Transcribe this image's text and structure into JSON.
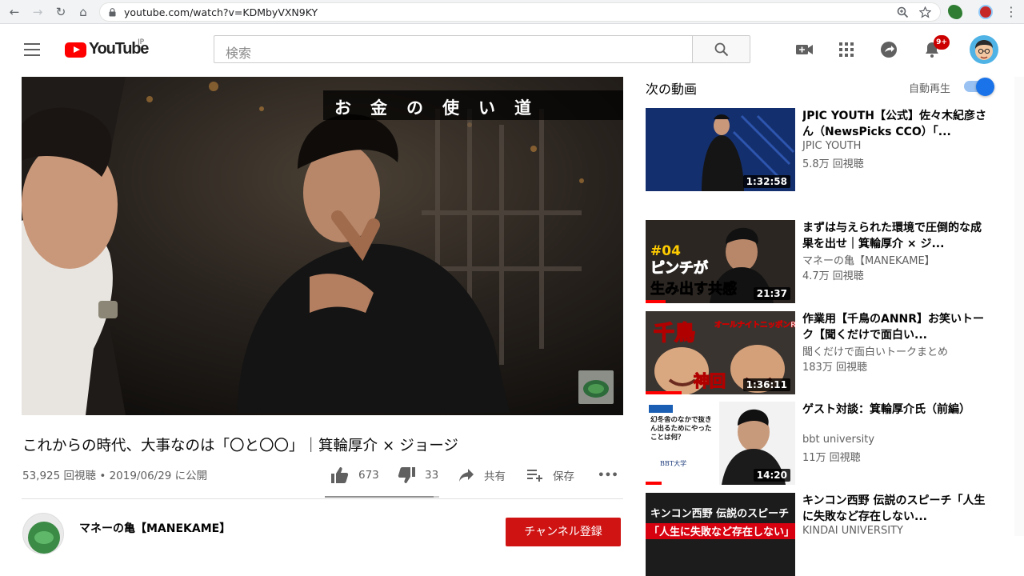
{
  "browser": {
    "url": "youtube.com/watch?v=KDMbyVXN9KY"
  },
  "header": {
    "logo_text": "YouTube",
    "logo_region": "JP",
    "search_placeholder": "検索",
    "notification_count": "9+"
  },
  "video": {
    "overlay_title": "お金の使い道",
    "title": "これからの時代、大事なのは「〇と〇〇」｜箕輪厚介 × ジョージ",
    "meta": "53,925 回視聴 • 2019/06/29 に公開",
    "likes": "673",
    "dislikes": "33",
    "share_label": "共有",
    "save_label": "保存",
    "more_label": "•••",
    "channel_name": "マネーの亀【MANEKAME】",
    "subscribe_label": "チャンネル登録"
  },
  "sidebar": {
    "heading": "次の動画",
    "autoplay_label": "自動再生",
    "autoplay_on": true,
    "items": [
      {
        "title": "JPIC YOUTH【公式】佐々木紀彦さん（NewsPicks CCO）「...",
        "channel": "JPIC YOUTH",
        "views": "5.8万 回視聴",
        "duration": "1:32:58"
      },
      {
        "title": "まずは与えられた環境で圧倒的な成果を出せ｜箕輪厚介 × ジ...",
        "channel": "マネーの亀【MANEKAME】",
        "views": "4.7万 回視聴",
        "duration": "21:37",
        "thumb_text_1": "#04",
        "thumb_text_2": "ピンチが",
        "thumb_text_3": "生み出す共感"
      },
      {
        "title": "作業用【千鳥のANNR】お笑いトーク【聞くだけで面白い...",
        "channel": "聞くだけで面白いトークまとめ",
        "views": "183万 回視聴",
        "duration": "1:36:11",
        "thumb_text_1": "千鳥",
        "thumb_text_2": "オールナイトニッポンR",
        "thumb_text_3": "神回"
      },
      {
        "title": "ゲスト対談：箕輪厚介氏（前編）",
        "channel": "bbt university",
        "views": "11万 回視聴",
        "duration": "14:20",
        "thumb_text_1": "幻冬舎のなかで抜きん出るためにやったことは何？",
        "thumb_text_2": "BBT大学"
      },
      {
        "title": "キンコン西野 伝説のスピーチ「人生に失敗など存在しない...",
        "channel": "KINDAI UNIVERSITY",
        "views": "",
        "duration": "",
        "thumb_text_1": "キンコン西野 伝説のスピーチ",
        "thumb_text_2": "「人生に失敗など存在しない」"
      }
    ]
  },
  "colors": {
    "brand_red": "#ff0000",
    "subscribe_red": "#cc0000",
    "toggle_blue": "#1a73e8"
  }
}
